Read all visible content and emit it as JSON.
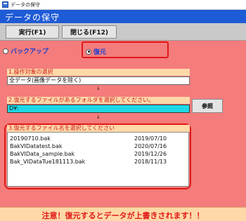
{
  "window": {
    "title": "データの保守"
  },
  "header": {
    "title": "データの保守"
  },
  "toolbar": {
    "run_label": "実行(F1)",
    "close_label": "閉じる(F12)"
  },
  "mode": {
    "backup_label": "バックアップ",
    "restore_label": "復元",
    "selected": "restore"
  },
  "step1": {
    "label": "1.操作対象の選択",
    "value": "全データ(画像データを除く)"
  },
  "step2": {
    "label": "2.復元するファイルがあるフォルダを選択してください。",
    "value": "D¥:",
    "browse_label": "参照"
  },
  "step3": {
    "label": "3.復元するファイル名を選択してください",
    "files": [
      {
        "name": "20190710.bak",
        "date": "2019/07/10"
      },
      {
        "name": "BakVIDatatest.bak",
        "date": "2020/07/16"
      },
      {
        "name": "BakVIData_sample.bak",
        "date": "2019/12/26"
      },
      {
        "name": "Bak_VIDataTue181113.bak",
        "date": "2018/11/13"
      }
    ]
  },
  "arrows": {
    "down": "↓"
  },
  "footer": {
    "warning": "注意！復元するとデータが上書きされます！！"
  },
  "colors": {
    "header": "#1e5bd6",
    "main_bg": "#f47c7c",
    "highlight": "#e01818",
    "folder_field": "#1ed8e8"
  }
}
